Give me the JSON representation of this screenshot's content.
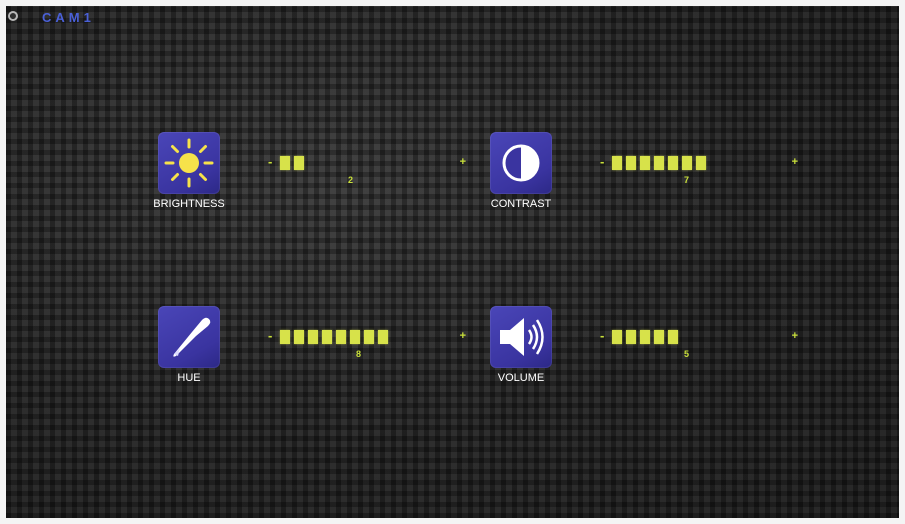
{
  "header": {
    "camera_label": "CAM1"
  },
  "controls": [
    {
      "label": "BRIGHTNESS",
      "minus": "-",
      "plus": "+",
      "value": "2",
      "level": 2,
      "icon": "sun-icon"
    },
    {
      "label": "CONTRAST",
      "minus": "-",
      "plus": "+",
      "value": "7",
      "level": 7,
      "icon": "contrast-icon"
    },
    {
      "label": "HUE",
      "minus": "-",
      "plus": "+",
      "value": "8",
      "level": 8,
      "icon": "dropper-icon"
    },
    {
      "label": "VOLUME",
      "minus": "-",
      "plus": "+",
      "value": "5",
      "level": 5,
      "icon": "speaker-icon"
    }
  ],
  "colors": {
    "icon_background": "#3a34a0",
    "level_bar": "#d7e24a",
    "camera_label": "#4a60d8"
  }
}
